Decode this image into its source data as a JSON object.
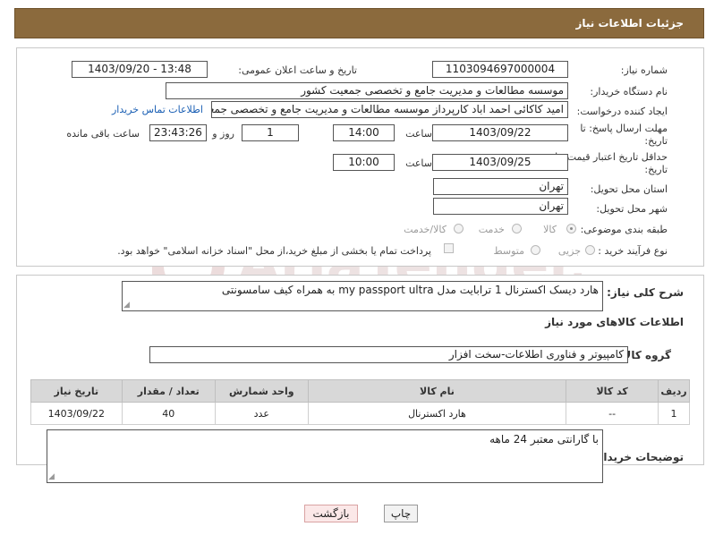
{
  "header": {
    "title": "جزئیات اطلاعات نیاز"
  },
  "watermark": {
    "text": "AriaTender.net",
    "color": "#e9d3d3"
  },
  "form": {
    "need_number_label": "شماره نیاز:",
    "need_number": "1103094697000004",
    "announce_label": "تاریخ و ساعت اعلان عمومی:",
    "announce_value": "1403/09/20 - 13:48",
    "buyer_label": "نام دستگاه خریدار:",
    "buyer_value": "موسسه مطالعات و مدیریت جامع و تخصصی جمعیت کشور",
    "creator_label": "ایجاد کننده درخواست:",
    "creator_value": "امید کاکائی احمد اباد کارپرداز موسسه مطالعات و مدیریت جامع و تخصصی جمعیت کشور",
    "contact_link": "اطلاعات تماس خریدار",
    "deadline_label_1": "مهلت ارسال پاسخ: تا",
    "deadline_label_2": "تاریخ:",
    "deadline_date": "1403/09/22",
    "time_label": "ساعت",
    "deadline_time": "14:00",
    "days_value": "1",
    "days_label": "روز و",
    "remaining_time": "23:43:26",
    "remaining_label": "ساعت باقی مانده",
    "validity_label_1": "حداقل تاریخ اعتبار قیمت: تا",
    "validity_label_2": "تاریخ:",
    "validity_date": "1403/09/25",
    "validity_time": "10:00",
    "province_label": "استان محل تحویل:",
    "province_value": "تهران",
    "city_label": "شهر محل تحویل:",
    "city_value": "تهران",
    "category_label": "طبقه بندی موضوعی:",
    "category_options": [
      "کالا",
      "خدمت",
      "کالا/خدمت"
    ],
    "category_selected": "کالا",
    "process_label": "نوع فرآیند خرید :",
    "process_options": [
      "جزیی",
      "متوسط"
    ],
    "payment_note": "پرداخت تمام یا بخشی از مبلغ خرید،از محل \"اسناد خزانه اسلامی\" خواهد بود."
  },
  "description": {
    "label": "شرح کلی نیاز:",
    "value": "هارد دیسک اکسترنال  1 ترابایت مدل my passport ultra به همراه کیف سامسونتی"
  },
  "goods_section": {
    "title": "اطلاعات کالاهای مورد نیاز",
    "group_label": "گروه کالا:",
    "group_value": "کامپیوتر و فناوری اطلاعات-سخت افزار"
  },
  "table": {
    "headers": [
      "ردیف",
      "کد کالا",
      "نام کالا",
      "واحد شمارش",
      "تعداد / مقدار",
      "تاریخ نیاز"
    ],
    "rows": [
      [
        "1",
        "--",
        "هارد اکسترنال",
        "عدد",
        "40",
        "1403/09/22"
      ]
    ]
  },
  "buyer_notes": {
    "label": "توضیحات خریدار:",
    "value": "با گارانتی معتبر 24 ماهه"
  },
  "buttons": {
    "print": "چاپ",
    "back": "بازگشت"
  }
}
